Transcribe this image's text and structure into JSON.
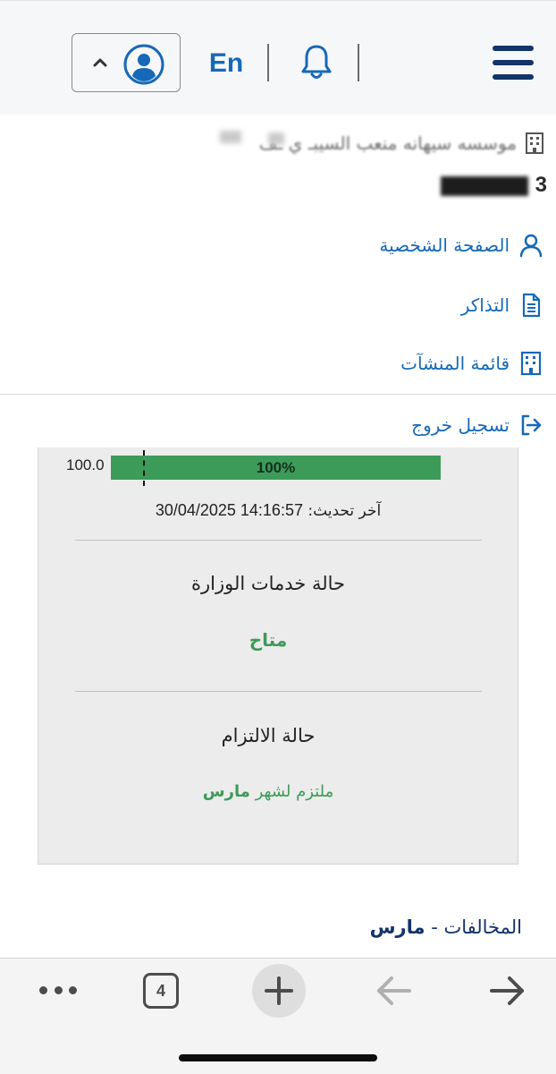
{
  "header": {
    "language_toggle": "En",
    "icons": {
      "menu": "hamburger-menu-icon",
      "notifications": "bell-icon",
      "user": "user-avatar-icon",
      "expand": "chevron-up-icon"
    }
  },
  "drawer": {
    "org_name": "موسسه سيهانه منعب السيبـ  ي  ـف",
    "account_number": "3",
    "items": [
      {
        "label": "الصفحة الشخصية",
        "icon": "person-icon"
      },
      {
        "label": "التذاكر",
        "icon": "document-icon"
      },
      {
        "label": "قائمة المنشآت",
        "icon": "building-icon"
      },
      {
        "label": "تسجيل خروج",
        "icon": "logout-icon"
      }
    ]
  },
  "status_card": {
    "bar_value_label": "100.0",
    "bar_percent_label": "100%",
    "bar_fraction": 1.0,
    "last_update_label": "آخر تحديث:",
    "last_update_value": "30/04/2025 14:16:57",
    "ministry_services_title": "حالة خدمات الوزارة",
    "ministry_services_value": "متاح",
    "commitment_title": "حالة الالتزام",
    "commitment_prefix": "ملتزم لشهر",
    "commitment_month": "مارس"
  },
  "violations": {
    "label": "المخالفات -",
    "month": "مارس"
  },
  "browser_toolbar": {
    "tab_count": "4",
    "icons": {
      "more": "more-dots-icon",
      "tabs": "tabs-icon",
      "new_tab": "plus-icon",
      "back": "arrow-left-icon",
      "forward": "arrow-right-icon"
    }
  },
  "colors": {
    "brand_navy": "#12346a",
    "link_blue": "#1669b8",
    "success_green": "#3d9b5a"
  }
}
